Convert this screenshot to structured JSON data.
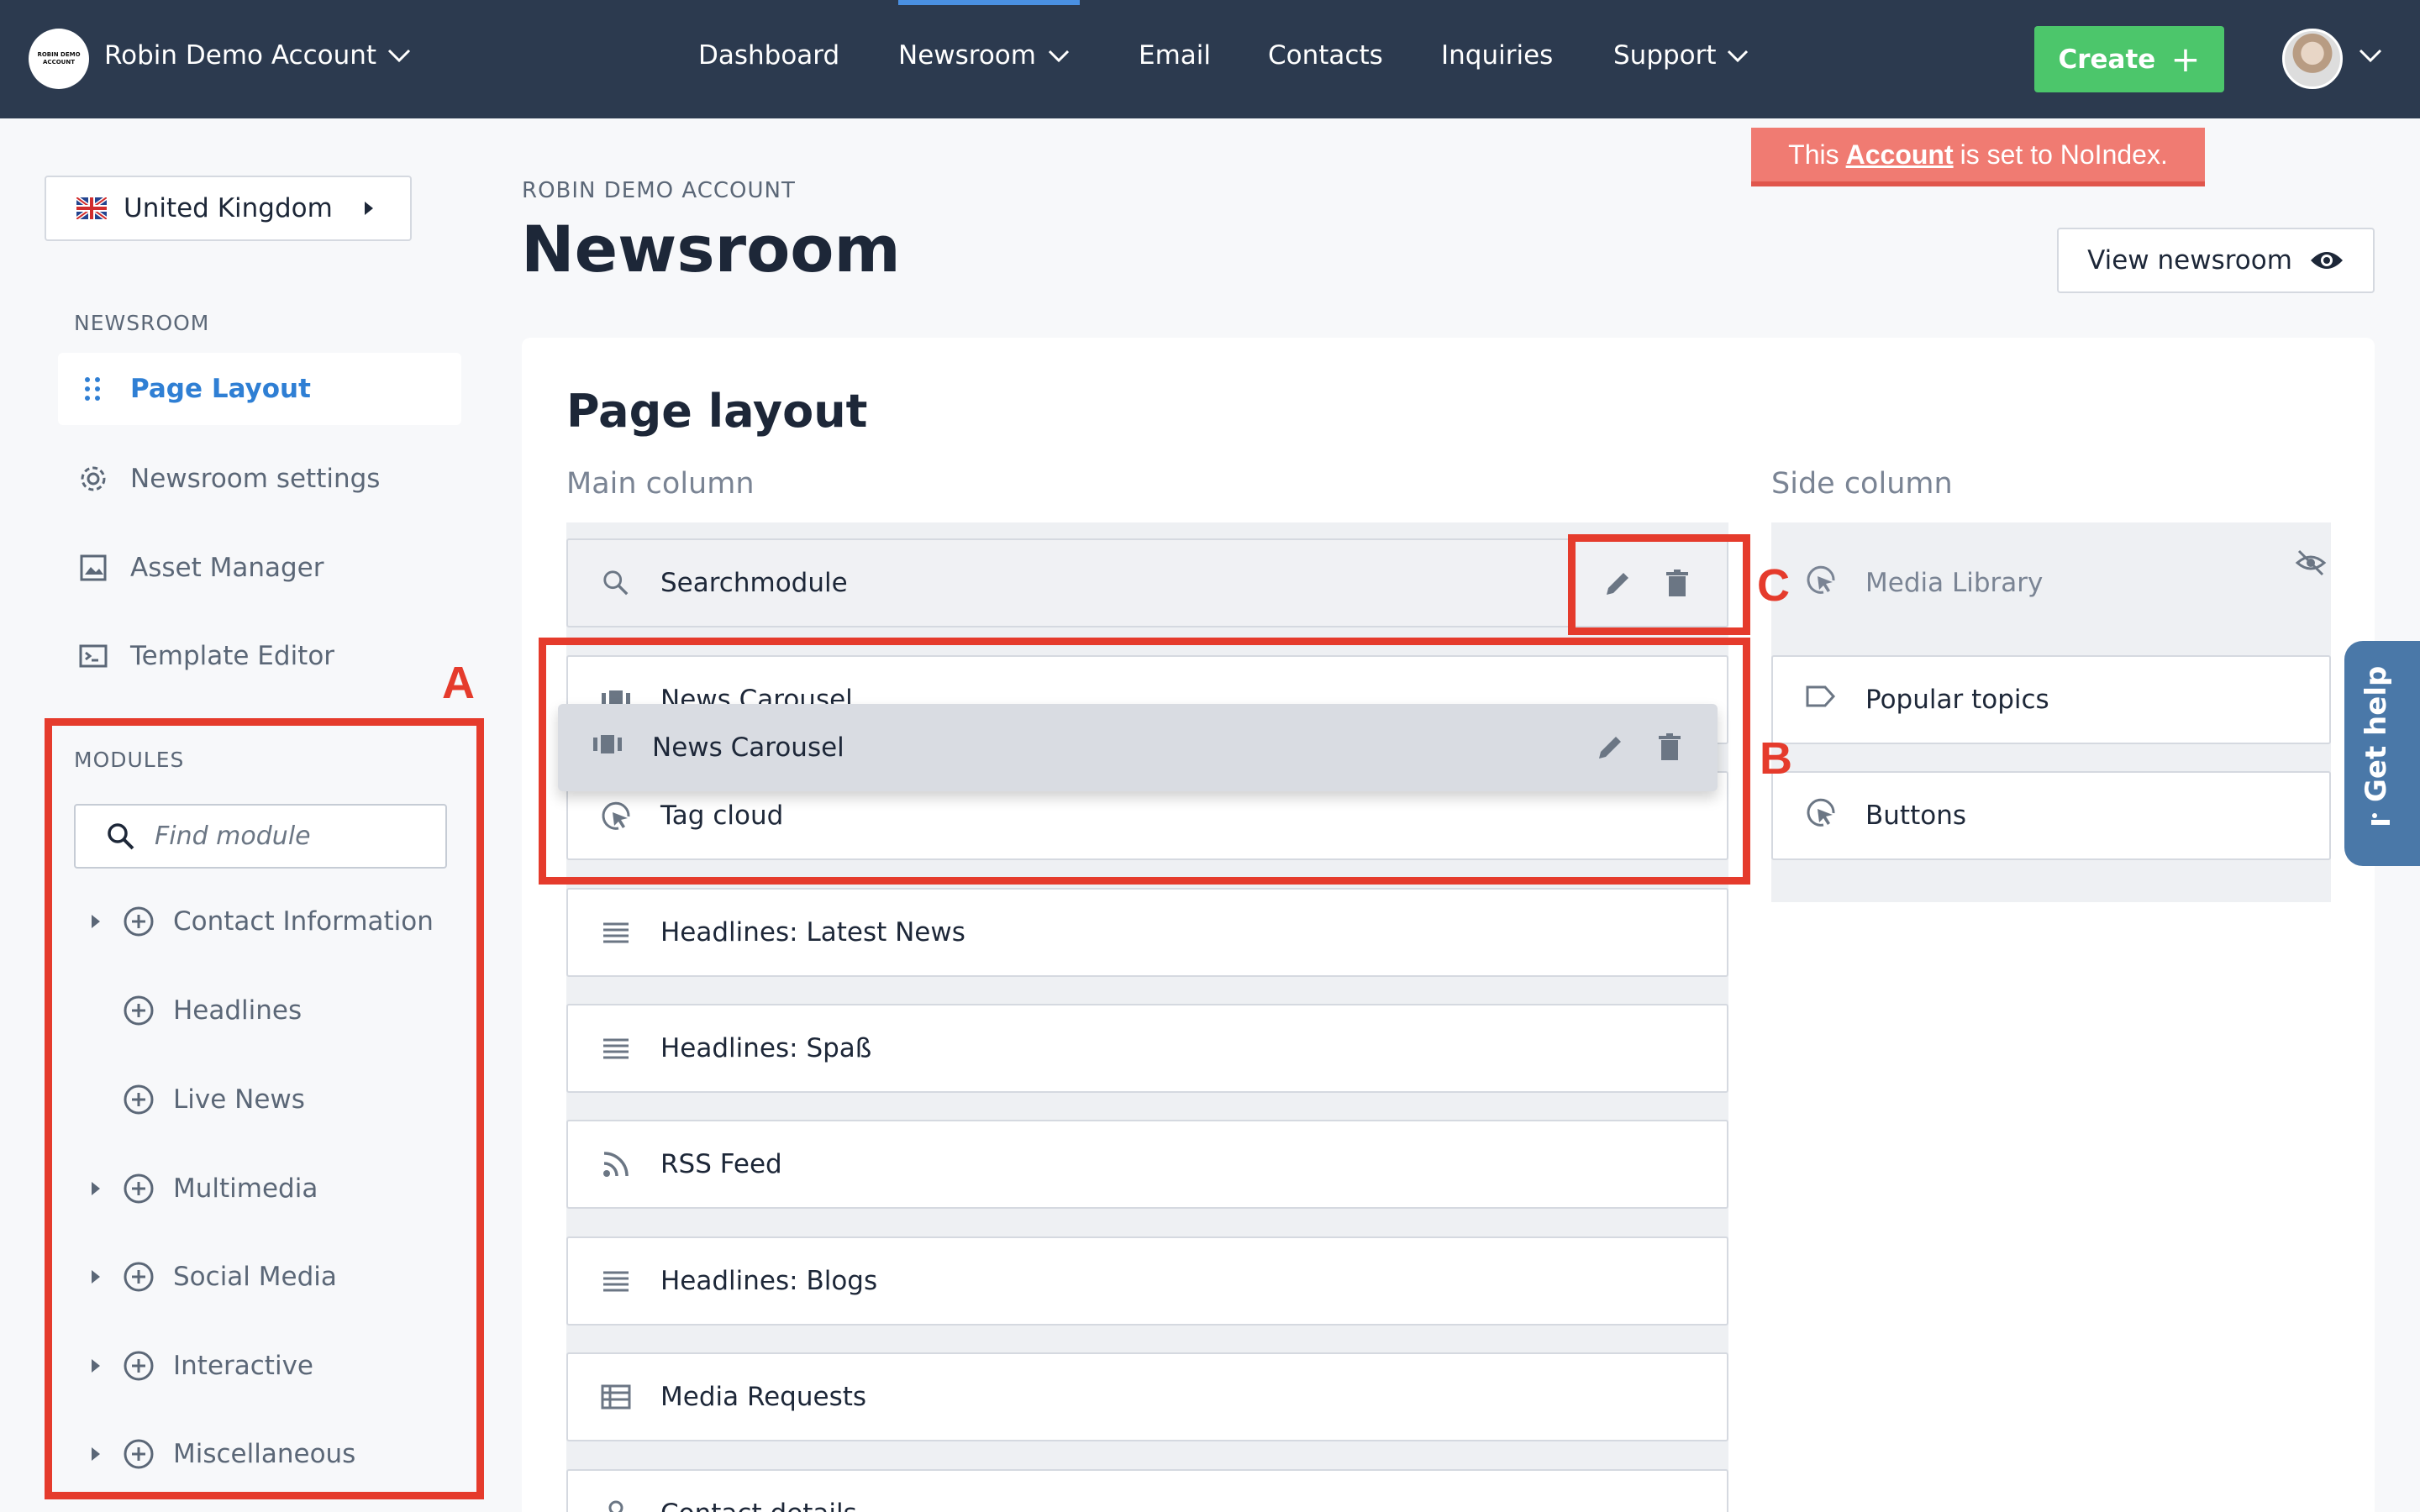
{
  "topbar": {
    "account_logo_text": "ROBIN DEMO ACCOUNT",
    "account_name": "Robin Demo Account",
    "nav": [
      "Dashboard",
      "Newsroom",
      "Email",
      "Contacts",
      "Inquiries",
      "Support"
    ],
    "active_nav": "Newsroom",
    "create_label": "Create"
  },
  "banner": {
    "prefix": "This",
    "link": "Account",
    "suffix": "is set to NoIndex."
  },
  "sidebar": {
    "country": "United Kingdom",
    "newsroom_heading": "NEWSROOM",
    "items": [
      {
        "label": "Page Layout",
        "icon": "grid-dots-icon",
        "active": true
      },
      {
        "label": "Newsroom settings",
        "icon": "gear-icon",
        "active": false
      },
      {
        "label": "Asset Manager",
        "icon": "image-icon",
        "active": false
      },
      {
        "label": "Template Editor",
        "icon": "code-window-icon",
        "active": false
      }
    ],
    "modules_heading": "MODULES",
    "find_placeholder": "Find module",
    "modules": [
      {
        "label": "Contact Information",
        "expandable": true
      },
      {
        "label": "Headlines",
        "expandable": false
      },
      {
        "label": "Live News",
        "expandable": false
      },
      {
        "label": "Multimedia",
        "expandable": true
      },
      {
        "label": "Social Media",
        "expandable": true
      },
      {
        "label": "Interactive",
        "expandable": true
      },
      {
        "label": "Miscellaneous",
        "expandable": true
      }
    ]
  },
  "header": {
    "crumb": "ROBIN DEMO ACCOUNT",
    "title": "Newsroom",
    "view_button": "View newsroom"
  },
  "layout": {
    "title": "Page layout",
    "main_column_label": "Main column",
    "side_column_label": "Side column",
    "main_modules": [
      "Searchmodule",
      "News Carousel",
      "Tag cloud",
      "Headlines: Latest News",
      "Headlines: Spaß",
      "RSS Feed",
      "Headlines: Blogs",
      "Media Requests",
      "Contact details"
    ],
    "dragging_module": "News Carousel",
    "side_modules": [
      {
        "label": "Media Library",
        "hidden": true
      },
      {
        "label": "Popular topics",
        "hidden": false
      },
      {
        "label": "Buttons",
        "hidden": false
      }
    ]
  },
  "annotations": [
    "A",
    "B",
    "C"
  ],
  "help_tab": "Get help",
  "colors": {
    "topbar": "#2c3a4f",
    "create": "#4cc66b",
    "accent": "#2f7fd4",
    "annotation_red": "#e53b2c",
    "banner": "#f07b72"
  }
}
